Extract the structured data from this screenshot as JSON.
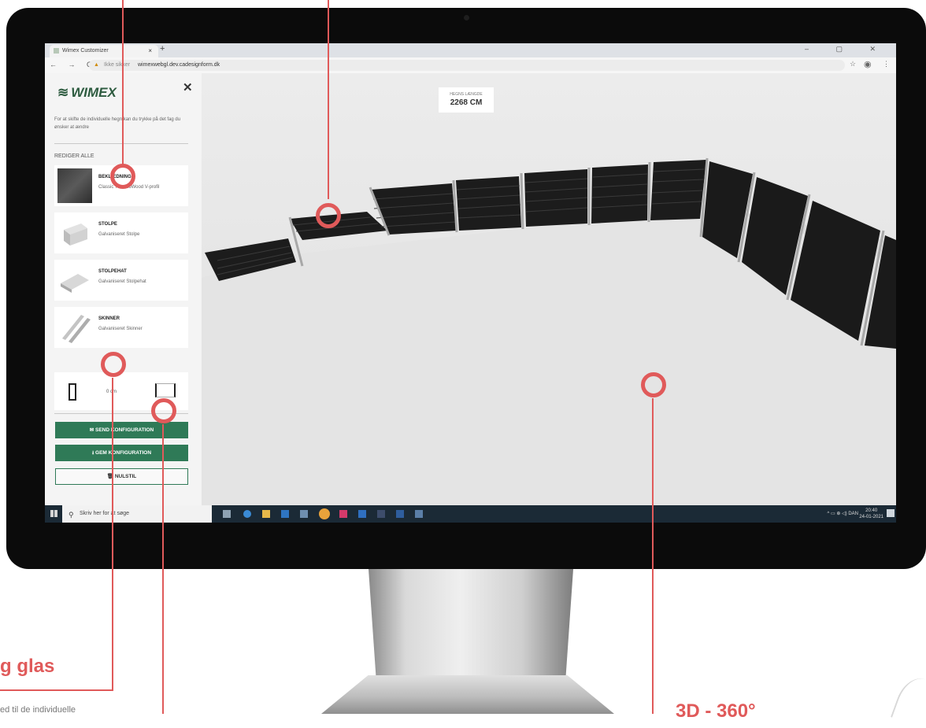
{
  "browser": {
    "tab_title": "Wimex Customizer",
    "tab_close": "×",
    "new_tab": "+",
    "window_controls": "– ▢ ✕",
    "nav_glyphs": "← → C",
    "warning_glyph": "▲",
    "security_text": "Ikke sikker",
    "url": "wimexwebgl.dev.cadesignform.dk",
    "star_glyph": "☆",
    "account_glyph": "◉",
    "menu_glyph": "⋮"
  },
  "sidebar": {
    "logo_icon": "≋",
    "logo_text": "WIMEX",
    "close_glyph": "✕",
    "hint": "For at skifte de individuelle hegn kan du trykke på det fag du ønsker at ændre",
    "edit_all": "REDIGER ALLE",
    "cards": [
      {
        "title": "BEKLÆDNING",
        "subtitle": "Classic ThermoWood V-profil",
        "icon": "cladding-thumbnail-icon"
      },
      {
        "title": "STOLPE",
        "subtitle": "Galvaniseret Stolpe",
        "icon": "post-thumbnail-icon"
      },
      {
        "title": "STOLPEHAT",
        "subtitle": "Galvaniseret Stolpehat",
        "icon": "post-cap-thumbnail-icon"
      },
      {
        "title": "SKINNER",
        "subtitle": "Galvaniseret Skinner",
        "icon": "rails-thumbnail-icon"
      }
    ],
    "dimension_value": "0 cm",
    "send_label": "SEND KONFIGURATION",
    "save_label": "GEM KONFIGURATION",
    "reset_label": "NULSTIL",
    "send_glyph": "✉",
    "save_glyph": "⭳",
    "reset_glyph": "🗑"
  },
  "viewport": {
    "length_label": "HEGNS LÆNGDE",
    "length_value": "2268 CM"
  },
  "taskbar": {
    "search_placeholder": "Skriv her for at søge",
    "search_glyph": "⚲",
    "tray": "^ ▭ ⊕ ◁) DAN",
    "time": "20:40",
    "date": "24-01-2021"
  },
  "annotations": {
    "label_left": "g glas",
    "label_right": "3D - 360°",
    "caption": "ed til de individuelle"
  },
  "colors": {
    "accent": "#e05a5a",
    "brand_green": "#2f7a57",
    "panel_dark": "#1c1c1c"
  }
}
